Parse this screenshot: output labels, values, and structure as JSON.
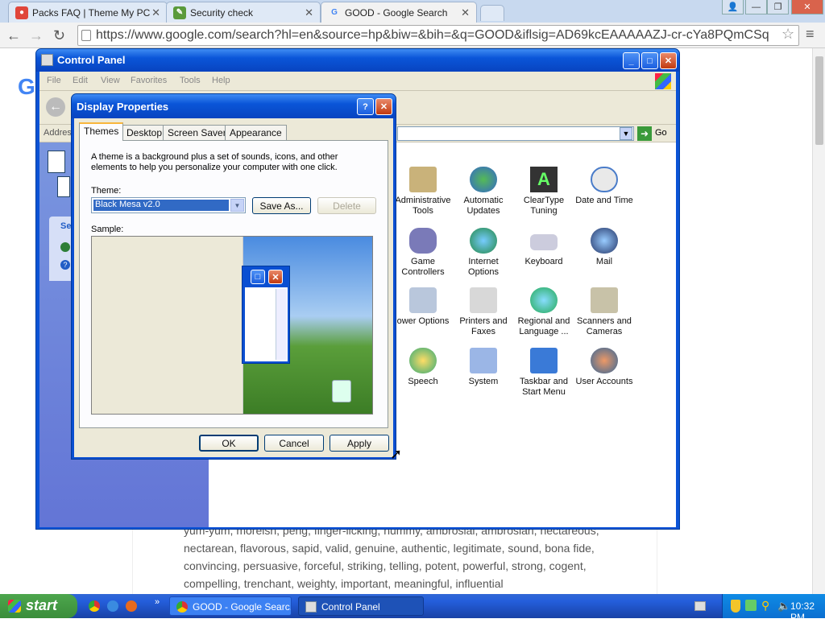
{
  "browser": {
    "tabs": [
      {
        "label": "Packs FAQ | Theme My PC"
      },
      {
        "label": "Security check"
      },
      {
        "label": "GOOD - Google Search"
      }
    ],
    "url": "https://www.google.com/search?hl=en&source=hp&biw=&bih=&q=GOOD&iflsig=AD69kcEAAAAAZJ-cr-cYa8PQmCSq"
  },
  "page": {
    "lines": [
      "yum-yum, moreish, peng, finger-licking, nummy, ambrosial, ambrosian, nectareous,",
      "nectarean, flavorous, sapid, valid, genuine, authentic, legitimate, sound, bona fide,",
      "convincing, persuasive, forceful, striking, telling, potent, powerful, strong, cogent,",
      "compelling, trenchant, weighty, important, meaningful, influential"
    ]
  },
  "control_panel": {
    "title": "Control Panel",
    "menu": [
      "File",
      "Edit",
      "View",
      "Favorites",
      "Tools",
      "Help"
    ],
    "address_label": "Addres",
    "go_label": "Go",
    "left_label": "Se",
    "icons": [
      {
        "label": "Administrative Tools"
      },
      {
        "label": "Automatic Updates"
      },
      {
        "label": "ClearType Tuning"
      },
      {
        "label": "Date and Time"
      },
      {
        "label": "Game Controllers"
      },
      {
        "label": "Internet Options"
      },
      {
        "label": "Keyboard"
      },
      {
        "label": "Mail"
      },
      {
        "label": "ower Options"
      },
      {
        "label": "Printers and Faxes"
      },
      {
        "label": "Regional and Language ..."
      },
      {
        "label": "Scanners and Cameras"
      },
      {
        "label": "Speech"
      },
      {
        "label": "System"
      },
      {
        "label": "Taskbar and Start Menu"
      },
      {
        "label": "User Accounts"
      }
    ]
  },
  "display_properties": {
    "title": "Display Properties",
    "tabs": [
      "Themes",
      "Desktop",
      "Screen Saver",
      "Appearance"
    ],
    "description": "A theme is a background plus a set of sounds, icons, and other elements to help you personalize your computer with one click.",
    "theme_label": "Theme:",
    "theme_value": "Black Mesa v2.0",
    "save_as": "Save As...",
    "delete": "Delete",
    "sample_label": "Sample:",
    "ok": "OK",
    "cancel": "Cancel",
    "apply": "Apply"
  },
  "taskbar": {
    "start": "start",
    "items": [
      {
        "label": "GOOD - Google Searc..."
      },
      {
        "label": "Control Panel"
      }
    ],
    "clock": "10:32 PM"
  },
  "colors": {
    "xp_blue": "#0a55d8",
    "xp_face": "#ece9d8",
    "start_green": "#3a8d3a"
  }
}
